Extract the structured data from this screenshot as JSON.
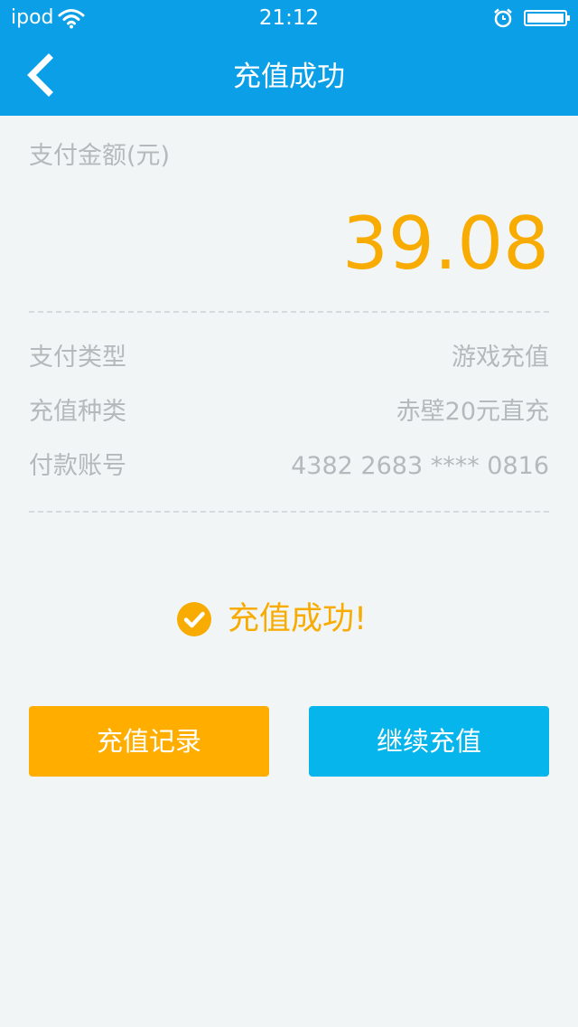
{
  "status_bar": {
    "carrier": "ipod",
    "time": "21:12"
  },
  "header": {
    "title": "充值成功"
  },
  "payment": {
    "amount_label": "支付金额(元)",
    "amount": "39.08",
    "rows": [
      {
        "label": "支付类型",
        "value": "游戏充值"
      },
      {
        "label": "充值种类",
        "value": "赤壁20元直充"
      },
      {
        "label": "付款账号",
        "value": "4382 2683 **** 0816"
      }
    ]
  },
  "result": {
    "message": "充值成功!"
  },
  "buttons": {
    "records": "充值记录",
    "continue": "继续充值"
  },
  "colors": {
    "header_blue": "#0a9fe7",
    "accent_orange": "#f8ab00",
    "button_orange": "#ffae00",
    "button_blue": "#05b5ec",
    "background": "#f2f5f5",
    "muted_text": "#b3b9bc"
  },
  "icons": {
    "wifi": "wifi-icon",
    "alarm": "alarm-icon",
    "battery": "battery-icon",
    "back": "chevron-left-icon",
    "success": "check-circle-icon"
  }
}
